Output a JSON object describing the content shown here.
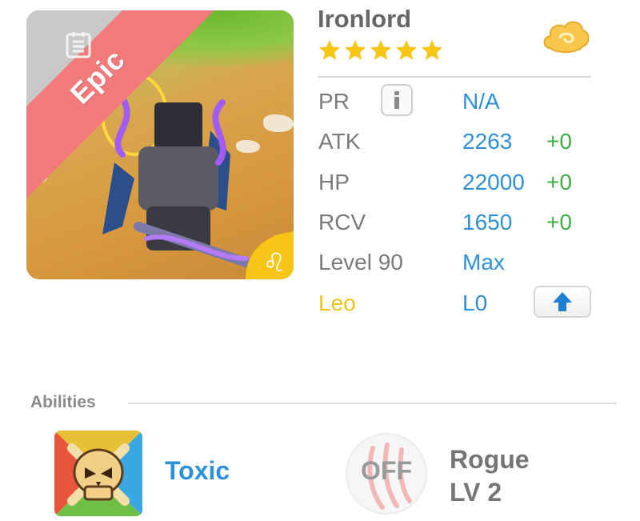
{
  "hero": {
    "name": "Ironlord",
    "rarity": "Epic",
    "star_count": 5,
    "star_color": "#f6c515",
    "zodiac_symbol": "♌"
  },
  "stats": [
    {
      "label": "PR",
      "value": "N/A",
      "bonus": ""
    },
    {
      "label": "ATK",
      "value": "2263",
      "bonus": "+0"
    },
    {
      "label": "HP",
      "value": "22000",
      "bonus": "+0"
    },
    {
      "label": "RCV",
      "value": "1650",
      "bonus": "+0"
    },
    {
      "label": "Level 90",
      "value": "Max",
      "bonus": ""
    },
    {
      "label": "Leo",
      "value": "L0",
      "bonus": ""
    }
  ],
  "icons": {
    "notes": "notes-icon",
    "currency": "cloud-icon",
    "info": "info-icon",
    "upgrade": "arrow-up-icon",
    "zodiac": "leo-icon",
    "ability": "skull-icon",
    "passive": "claw-icon"
  },
  "abilities": {
    "title": "Abilities",
    "active": {
      "name": "Toxic"
    },
    "passive": {
      "state": "OFF",
      "name": "Rogue",
      "level": "LV 2"
    }
  },
  "colors": {
    "value_blue": "#2f8fd8",
    "bonus_green": "#3fae46",
    "zodiac_yellow": "#f2c218",
    "epic_ribbon": "#f27a7a"
  }
}
